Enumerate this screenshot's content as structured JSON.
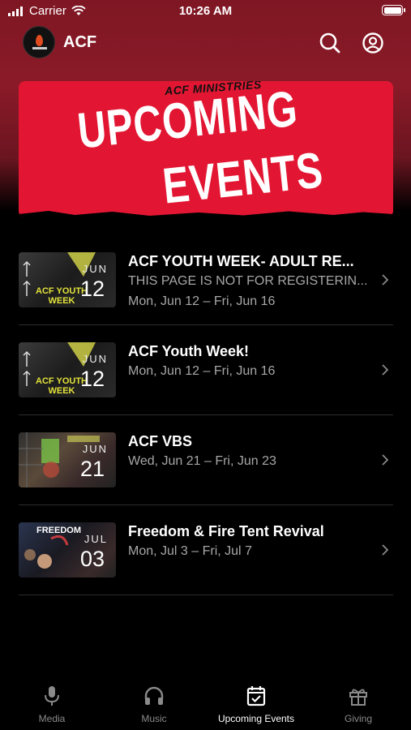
{
  "status": {
    "carrier": "Carrier",
    "time": "10:26 AM"
  },
  "header": {
    "title": "ACF"
  },
  "banner": {
    "subtitle": "ACF MINISTRIES",
    "line1": "UPCOMING",
    "line2": "EVENTS"
  },
  "events": [
    {
      "title": "ACF YOUTH WEEK- ADULT RE...",
      "note": "THIS PAGE IS NOT FOR REGISTERIN...",
      "dates": "Mon, Jun 12 – Fri, Jun 16",
      "month": "JUN",
      "day": "12",
      "thumb_text": "ACF YOUTH WEEK"
    },
    {
      "title": "ACF Youth Week!",
      "note": "",
      "dates": "Mon, Jun 12 – Fri, Jun 16",
      "month": "JUN",
      "day": "12",
      "thumb_text": "ACF YOUTH WEEK"
    },
    {
      "title": "ACF VBS",
      "note": "",
      "dates": "Wed, Jun 21 – Fri, Jun 23",
      "month": "JUN",
      "day": "21",
      "thumb_text": ""
    },
    {
      "title": "Freedom & Fire Tent Revival",
      "note": "",
      "dates": "Mon, Jul 3 – Fri, Jul 7",
      "month": "JUL",
      "day": "03",
      "thumb_text": "FREEDOM"
    }
  ],
  "tabs": [
    {
      "label": "Media",
      "icon": "microphone-icon"
    },
    {
      "label": "Music",
      "icon": "headphones-icon"
    },
    {
      "label": "Upcoming Events",
      "icon": "calendar-check-icon",
      "active": true
    },
    {
      "label": "Giving",
      "icon": "gift-icon"
    }
  ]
}
